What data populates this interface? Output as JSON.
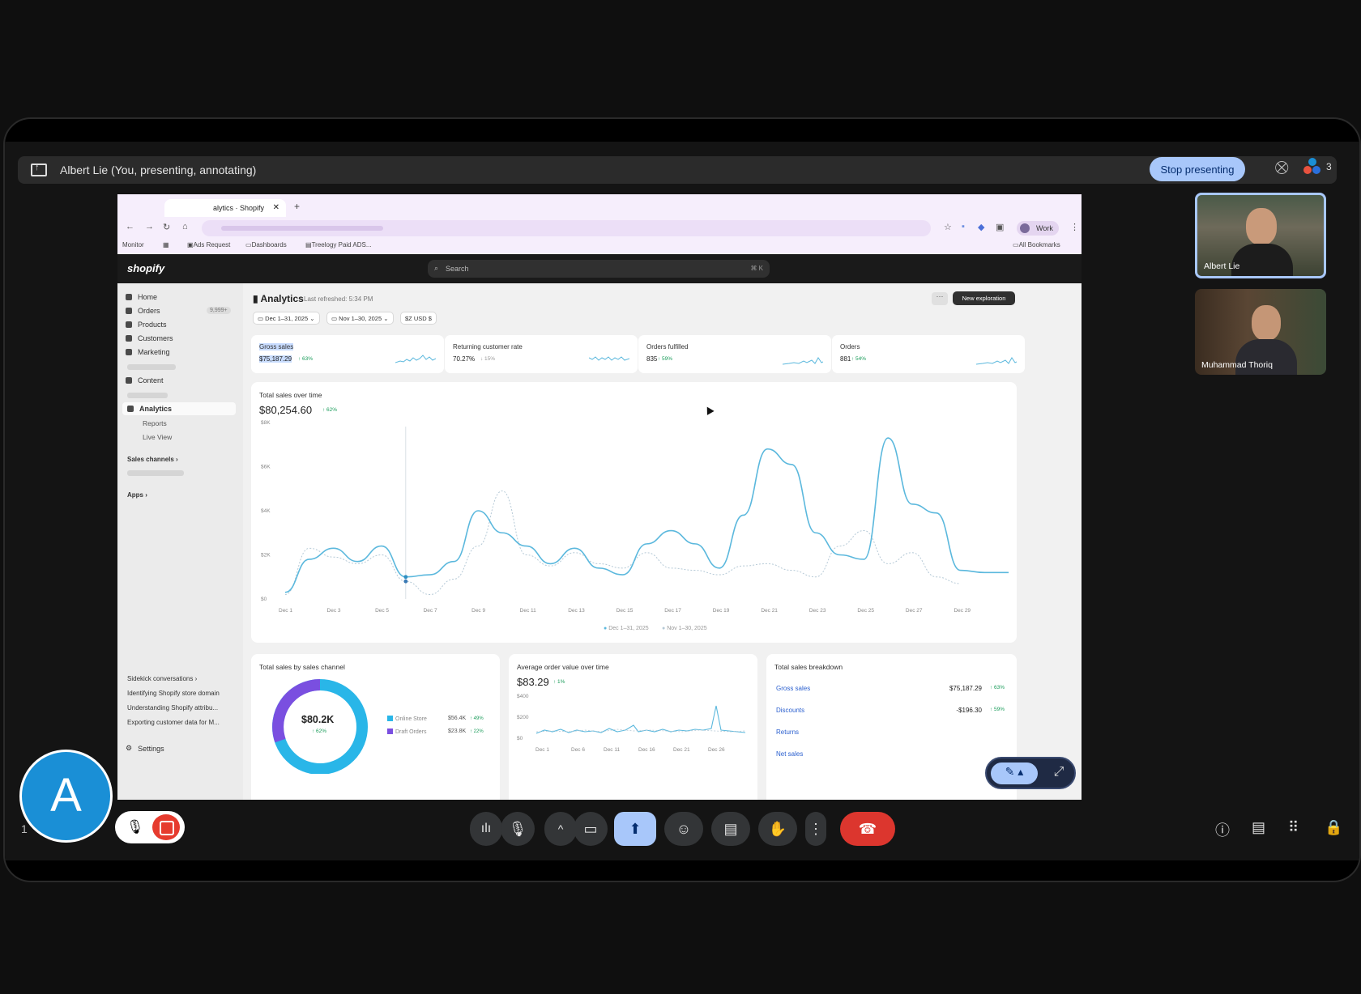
{
  "meet": {
    "presenting_label": "Albert Lie (You, presenting, annotating)",
    "stop_presenting": "Stop presenting",
    "participant_count": "3",
    "tiles": [
      {
        "name": "Albert Lie"
      },
      {
        "name": "Muhammad Thoriq"
      }
    ],
    "self_avatar_letter": "A",
    "self_name_fragment": "1"
  },
  "browser": {
    "tab_title": "alytics · Shopify",
    "profile": "Work",
    "bookmarks": [
      "Monitor",
      "Ads Request",
      "Dashboards",
      "Treelogy Paid ADS...",
      "All Bookmarks"
    ]
  },
  "shopify": {
    "logo": "shopify",
    "search_placeholder": "Search",
    "search_shortcut": "⌘ K",
    "sidebar": {
      "home": "Home",
      "orders": "Orders",
      "orders_count": "9,999+",
      "products": "Products",
      "customers": "Customers",
      "marketing": "Marketing",
      "content": "Content",
      "analytics": "Analytics",
      "reports": "Reports",
      "live_view": "Live View",
      "sales_channels": "Sales channels",
      "apps": "Apps",
      "sidekick": "Sidekick conversations",
      "convos": [
        "Identifying Shopify store domain",
        "Understanding Shopify attribu...",
        "Exporting customer data for M..."
      ],
      "settings": "Settings"
    },
    "header": {
      "title": "Analytics",
      "last_refreshed": "Last refreshed: 5:34 PM",
      "more": "···",
      "new_exploration": "New exploration"
    },
    "filters": [
      "Dec 1–31, 2025",
      "Nov 1–30, 2025",
      "$Z USD $"
    ],
    "kpis": [
      {
        "label": "Gross sales",
        "value": "$75,187.29",
        "change": "↑ 63%"
      },
      {
        "label": "Returning customer rate",
        "value": "70.27%",
        "change": "↓ 15%"
      },
      {
        "label": "Orders fulfilled",
        "value": "835",
        "change": "↑ 59%"
      },
      {
        "label": "Orders",
        "value": "881",
        "change": "↑ 54%"
      }
    ],
    "total_sales": {
      "title": "Total sales over time",
      "value": "$80,254.60",
      "change": "↑ 62%",
      "legend_current": "Dec 1–31, 2025",
      "legend_previous": "Nov 1–30, 2025"
    },
    "channel": {
      "title": "Total sales by sales channel",
      "center_value": "$80.2K",
      "center_change": "↑ 62%",
      "items": [
        {
          "name": "Online Store",
          "value": "$56.4K",
          "change": "↑ 49%",
          "color": "#29b6e8"
        },
        {
          "name": "Draft Orders",
          "value": "$23.8K",
          "change": "↑ 22%",
          "color": "#7a4fe0"
        }
      ]
    },
    "aov": {
      "title": "Average order value over time",
      "value": "$83.29",
      "change": "↑ 1%",
      "y_ticks": [
        "$400",
        "$200",
        "$0"
      ],
      "x_ticks": [
        "Dec 1",
        "Dec 6",
        "Dec 11",
        "Dec 16",
        "Dec 21",
        "Dec 26"
      ]
    },
    "breakdown": {
      "title": "Total sales breakdown",
      "rows": [
        {
          "label": "Gross sales",
          "value": "$75,187.29",
          "change": "↑ 63%"
        },
        {
          "label": "Discounts",
          "value": "-$196.30",
          "change": "↑ 59%"
        },
        {
          "label": "Returns",
          "value": "",
          "change": ""
        },
        {
          "label": "Net sales",
          "value": "",
          "change": ""
        }
      ]
    }
  },
  "chart_data": {
    "type": "line",
    "title": "Total sales over time",
    "x": [
      "Dec 1",
      "Dec 2",
      "Dec 3",
      "Dec 4",
      "Dec 5",
      "Dec 6",
      "Dec 7",
      "Dec 8",
      "Dec 9",
      "Dec 10",
      "Dec 11",
      "Dec 12",
      "Dec 13",
      "Dec 14",
      "Dec 15",
      "Dec 16",
      "Dec 17",
      "Dec 18",
      "Dec 19",
      "Dec 20",
      "Dec 21",
      "Dec 22",
      "Dec 23",
      "Dec 24",
      "Dec 25",
      "Dec 26",
      "Dec 27",
      "Dec 28",
      "Dec 29",
      "Dec 30",
      "Dec 31"
    ],
    "x_tick_labels": [
      "Dec 1",
      "Dec 3",
      "Dec 5",
      "Dec 7",
      "Dec 9",
      "Dec 11",
      "Dec 13",
      "Dec 15",
      "Dec 17",
      "Dec 19",
      "Dec 21",
      "Dec 23",
      "Dec 25",
      "Dec 27",
      "Dec 29"
    ],
    "y_tick_labels": [
      "$8K",
      "$6K",
      "$4K",
      "$2K",
      "$0"
    ],
    "ylim": [
      0,
      8000
    ],
    "series": [
      {
        "name": "Dec 1–31, 2025",
        "color": "#5bb8dd",
        "values": [
          300,
          1800,
          2300,
          1700,
          2400,
          1000,
          1100,
          1700,
          4000,
          3000,
          2400,
          1600,
          2300,
          1400,
          1100,
          2500,
          3100,
          2500,
          1400,
          3800,
          6800,
          6100,
          3000,
          2000,
          1800,
          7300,
          4300,
          3900,
          1300,
          1200,
          1200
        ]
      },
      {
        "name": "Nov 1–30, 2025",
        "color": "#b5c9d6",
        "values": [
          200,
          2300,
          1900,
          1600,
          2000,
          800,
          200,
          900,
          2400,
          4900,
          2000,
          1500,
          2100,
          1600,
          1400,
          2100,
          1400,
          1300,
          1100,
          1500,
          1600,
          1300,
          1000,
          2400,
          3100,
          1600,
          2100,
          1000,
          700,
          null,
          null
        ]
      }
    ]
  }
}
